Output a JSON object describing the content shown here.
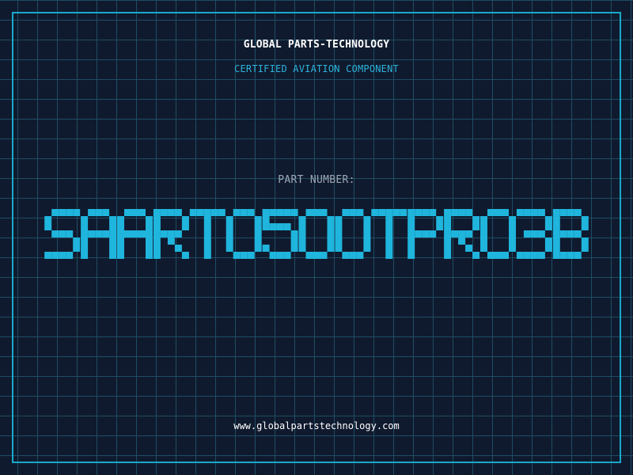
{
  "header": {
    "brand": "GLOBAL PARTS-TECHNOLOGY",
    "tagline": "CERTIFIED AVIATION COMPONENT"
  },
  "part": {
    "label": "PART NUMBER:",
    "number": "SAART0500TPR03B"
  },
  "footer": {
    "website": "www.globalpartstechnology.com"
  },
  "colors": {
    "background": "#101a2e",
    "grid": "#1e4d63",
    "accent": "#1fb5dd",
    "frame": "#1aa9cc",
    "label": "#9ba7b5"
  }
}
